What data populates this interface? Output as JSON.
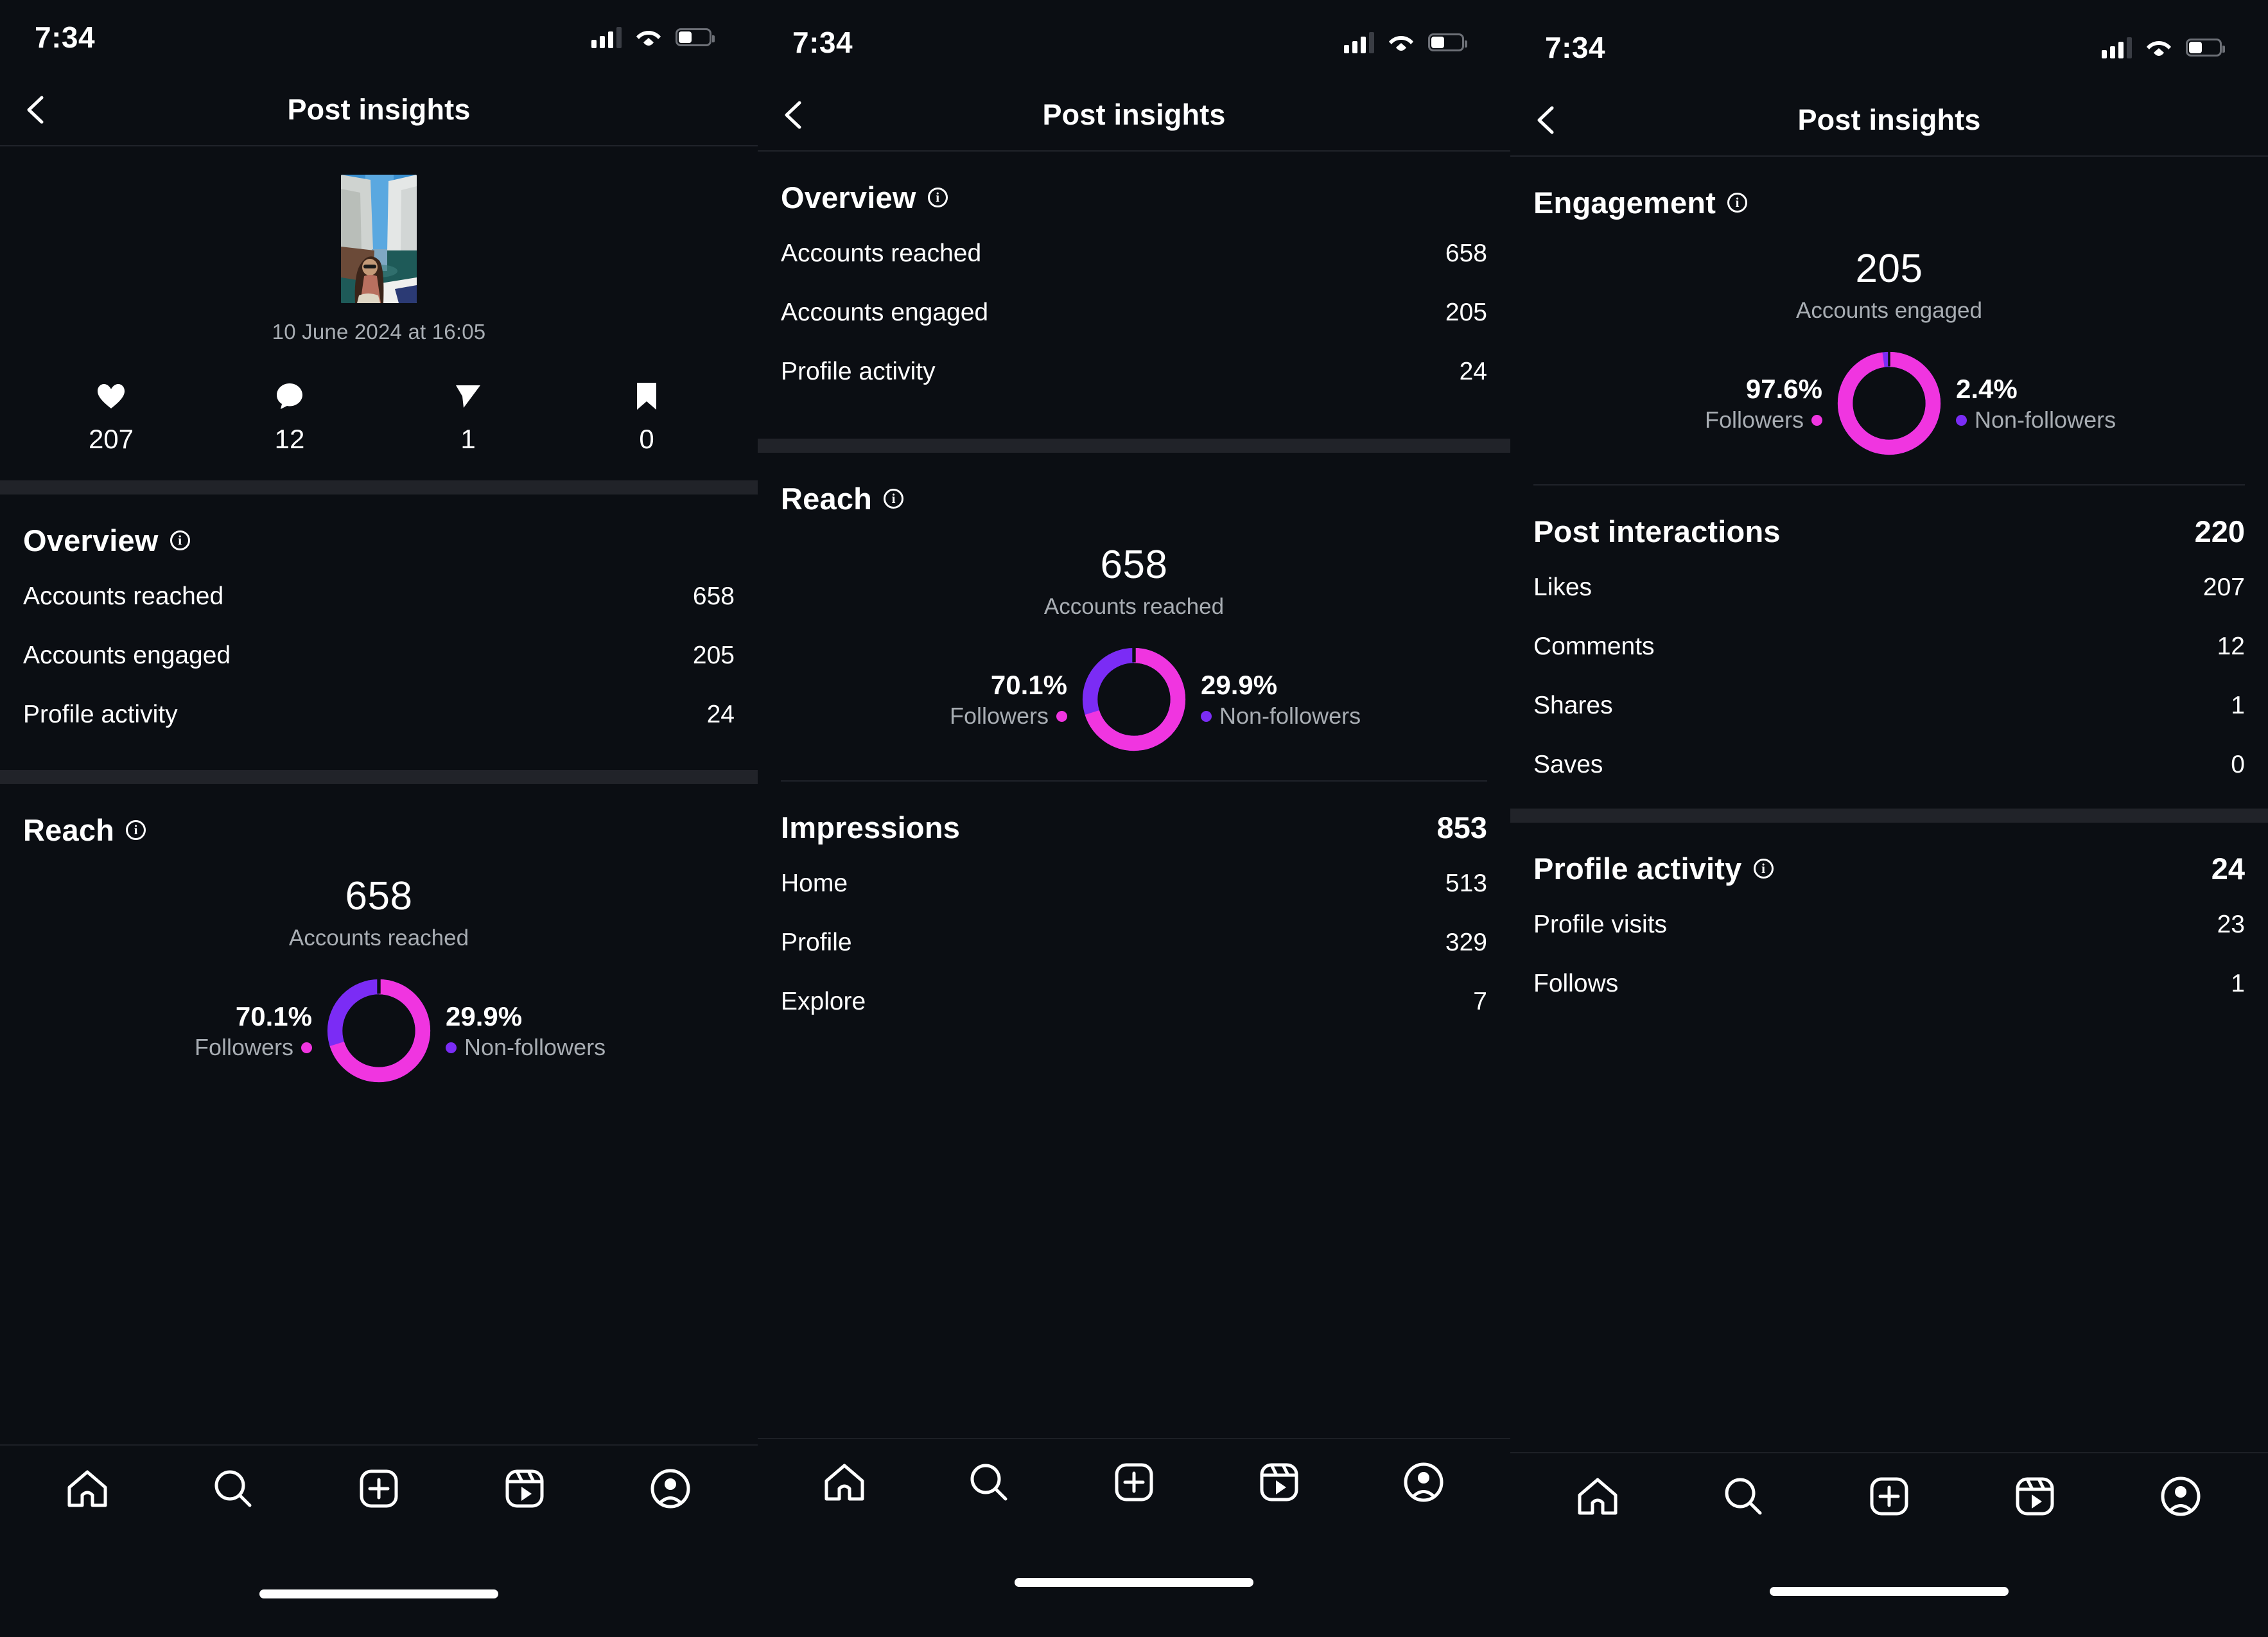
{
  "statusbar": {
    "time": "7:34"
  },
  "navbar": {
    "title": "Post insights",
    "back_icon": "chevron-left-icon"
  },
  "panel1": {
    "post": {
      "date": "10 June 2024 at 16:05",
      "metrics": [
        {
          "icon": "heart-icon",
          "name": "likes",
          "value": "207"
        },
        {
          "icon": "comment-icon",
          "name": "comments",
          "value": "12"
        },
        {
          "icon": "share-icon",
          "name": "shares",
          "value": "1"
        },
        {
          "icon": "bookmark-icon",
          "name": "saves",
          "value": "0"
        }
      ]
    },
    "overview": {
      "title": "Overview",
      "rows": [
        {
          "label": "Accounts reached",
          "value": "658"
        },
        {
          "label": "Accounts engaged",
          "value": "205"
        },
        {
          "label": "Profile activity",
          "value": "24"
        }
      ]
    },
    "reach": {
      "title": "Reach",
      "big": "658",
      "sub": "Accounts reached",
      "left_pct": "70.1%",
      "left_label": "Followers",
      "right_pct": "29.9%",
      "right_label": "Non-followers"
    }
  },
  "panel2": {
    "overview": {
      "title": "Overview",
      "rows": [
        {
          "label": "Accounts reached",
          "value": "658"
        },
        {
          "label": "Accounts engaged",
          "value": "205"
        },
        {
          "label": "Profile activity",
          "value": "24"
        }
      ]
    },
    "reach": {
      "title": "Reach",
      "big": "658",
      "sub": "Accounts reached",
      "left_pct": "70.1%",
      "left_label": "Followers",
      "right_pct": "29.9%",
      "right_label": "Non-followers"
    },
    "impressions": {
      "title": "Impressions",
      "total": "853",
      "rows": [
        {
          "label": "Home",
          "value": "513"
        },
        {
          "label": "Profile",
          "value": "329"
        },
        {
          "label": "Explore",
          "value": "7"
        }
      ]
    }
  },
  "panel3": {
    "engagement": {
      "title": "Engagement",
      "big": "205",
      "sub": "Accounts engaged",
      "left_pct": "97.6%",
      "left_label": "Followers",
      "right_pct": "2.4%",
      "right_label": "Non-followers"
    },
    "interactions": {
      "title": "Post interactions",
      "total": "220",
      "rows": [
        {
          "label": "Likes",
          "value": "207"
        },
        {
          "label": "Comments",
          "value": "12"
        },
        {
          "label": "Shares",
          "value": "1"
        },
        {
          "label": "Saves",
          "value": "0"
        }
      ]
    },
    "profile_activity": {
      "title": "Profile activity",
      "total": "24",
      "rows": [
        {
          "label": "Profile visits",
          "value": "23"
        },
        {
          "label": "Follows",
          "value": "1"
        }
      ]
    }
  },
  "tabbar": {
    "items": [
      {
        "icon": "home-icon",
        "name": "tab-home"
      },
      {
        "icon": "search-icon",
        "name": "tab-search"
      },
      {
        "icon": "add-post-icon",
        "name": "tab-create"
      },
      {
        "icon": "reels-icon",
        "name": "tab-reels"
      },
      {
        "icon": "profile-icon",
        "name": "tab-profile"
      }
    ]
  },
  "colors": {
    "background": "#0B0E13",
    "separator": "#212329",
    "followers": "#F035E0",
    "followers_alt": "#FF3BEF",
    "non_followers": "#7B2CF5",
    "muted_text": "#A8ADB3"
  },
  "chart_data": [
    {
      "type": "pie",
      "title": "Reach",
      "subtitle": "658 Accounts reached",
      "categories": [
        "Followers",
        "Non-followers"
      ],
      "values": [
        70.1,
        29.9
      ],
      "unit": "%",
      "colors": [
        "#F035E0",
        "#7B2CF5"
      ],
      "legend": "sides",
      "donut": true
    },
    {
      "type": "pie",
      "title": "Engagement",
      "subtitle": "205 Accounts engaged",
      "categories": [
        "Followers",
        "Non-followers"
      ],
      "values": [
        97.6,
        2.4
      ],
      "unit": "%",
      "colors": [
        "#F035E0",
        "#7B2CF5"
      ],
      "legend": "sides",
      "donut": true
    }
  ]
}
